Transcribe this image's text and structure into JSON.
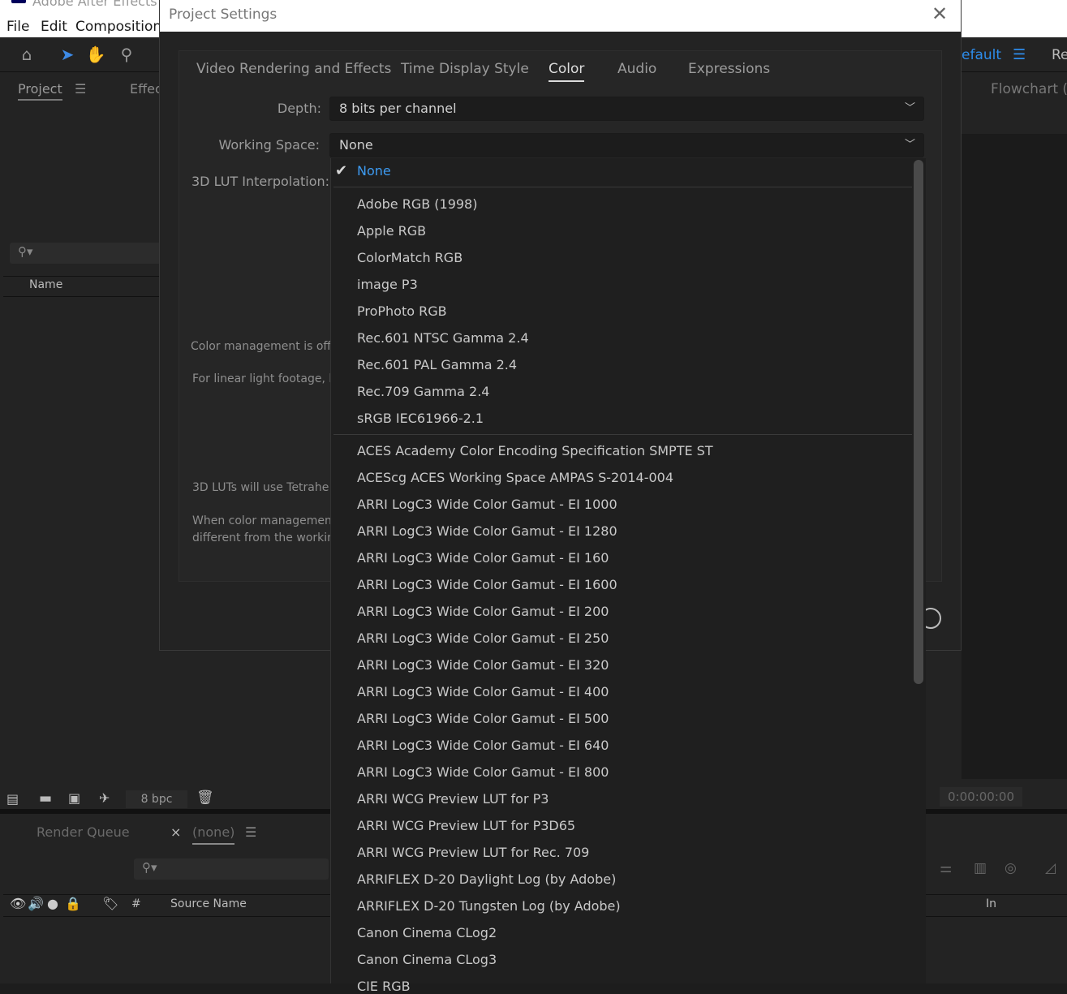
{
  "app": {
    "title": "Adobe After Effects",
    "menu": [
      "File",
      "Edit",
      "Composition"
    ],
    "workspace_default": "efault",
    "workspace_re": "Re",
    "flowchart_tab": "Flowchart (n",
    "project_tab": "Project",
    "effects_tab": "Effec",
    "name_column": "Name",
    "bpc": "8 bpc",
    "timecode": "0:00:00:00",
    "render_queue_tab": "Render Queue",
    "comp_close": "×",
    "comp_tab": "(none)",
    "hash_column": "#",
    "source_name_column": "Source Name",
    "in_column": "In"
  },
  "dialog": {
    "title": "Project Settings",
    "close_label": "✕",
    "tabs": [
      {
        "label": "Video Rendering and Effects",
        "active": false
      },
      {
        "label": "Time Display Style",
        "active": false
      },
      {
        "label": "Color",
        "active": true
      },
      {
        "label": "Audio",
        "active": false
      },
      {
        "label": "Expressions",
        "active": false
      }
    ],
    "depth_label": "Depth:",
    "depth_value": "8 bits per channel",
    "working_space_label": "Working Space:",
    "working_space_value": "None",
    "lut_label": "3D LUT Interpolation:",
    "text1": "Color management is off. T",
    "text2": "For linear light footage, li",
    "text3": "3D LUTs will use Tetrahe",
    "text4a": "When color managemen",
    "text4b": "different from the workin"
  },
  "dropdown": {
    "selected": "None",
    "group1": [
      "Adobe RGB (1998)",
      "Apple RGB",
      "ColorMatch RGB",
      "image P3",
      "ProPhoto RGB",
      "Rec.601 NTSC Gamma 2.4",
      "Rec.601 PAL Gamma 2.4",
      "Rec.709 Gamma 2.4",
      "sRGB IEC61966-2.1"
    ],
    "group2": [
      "ACES Academy Color Encoding Specification SMPTE ST",
      "ACEScg ACES Working Space AMPAS S-2014-004",
      "ARRI LogC3 Wide Color Gamut - EI 1000",
      "ARRI LogC3 Wide Color Gamut - EI 1280",
      "ARRI LogC3 Wide Color Gamut - EI 160",
      "ARRI LogC3 Wide Color Gamut - EI 1600",
      "ARRI LogC3 Wide Color Gamut - EI 200",
      "ARRI LogC3 Wide Color Gamut - EI 250",
      "ARRI LogC3 Wide Color Gamut - EI 320",
      "ARRI LogC3 Wide Color Gamut - EI 400",
      "ARRI LogC3 Wide Color Gamut - EI 500",
      "ARRI LogC3 Wide Color Gamut - EI 640",
      "ARRI LogC3 Wide Color Gamut - EI 800",
      "ARRI WCG Preview LUT for P3",
      "ARRI WCG Preview LUT for P3D65",
      "ARRI WCG Preview LUT for Rec. 709",
      "ARRIFLEX D-20 Daylight Log (by Adobe)",
      "ARRIFLEX D-20 Tungsten Log (by Adobe)",
      "Canon Cinema CLog2",
      "Canon Cinema CLog3",
      "CIE RGB"
    ]
  },
  "colors": {
    "selected_item": "#3d9bf2",
    "workspace_accent": "#2d8ceb",
    "dialog_bg": "#232323"
  },
  "icons": [
    "home-icon",
    "selection-arrow-icon",
    "hand-icon",
    "zoom-icon",
    "search-icon",
    "chevron-down-icon",
    "checkmark-icon",
    "close-icon",
    "trash-icon",
    "folder-icon",
    "eye-icon",
    "audio-icon",
    "solo-icon",
    "lock-icon",
    "label-icon"
  ]
}
